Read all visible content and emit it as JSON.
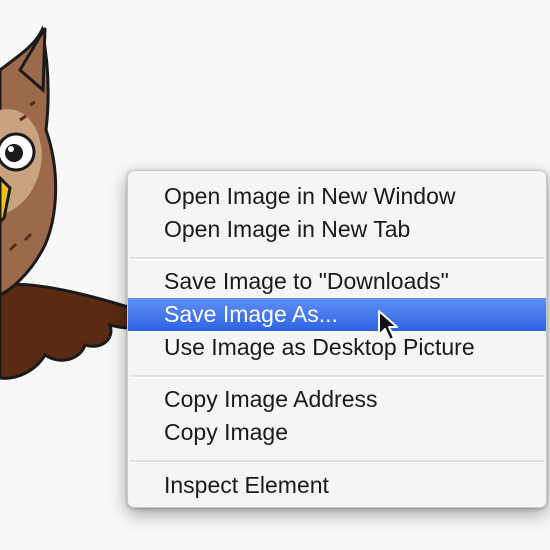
{
  "background_image": {
    "subject": "owl-illustration",
    "colors": {
      "body": "#9b6a4a",
      "wing": "#5a2a12",
      "eye_white": "#ffffff",
      "beak": "#f2c21b",
      "outline": "#1a1a1a"
    }
  },
  "context_menu": {
    "groups": [
      {
        "items": [
          {
            "label": "Open Image in New Window",
            "highlighted": false
          },
          {
            "label": "Open Image in New Tab",
            "highlighted": false
          }
        ]
      },
      {
        "items": [
          {
            "label": "Save Image to \"Downloads\"",
            "highlighted": false
          },
          {
            "label": "Save Image As...",
            "highlighted": true
          },
          {
            "label": "Use Image as Desktop Picture",
            "highlighted": false
          }
        ]
      },
      {
        "items": [
          {
            "label": "Copy Image Address",
            "highlighted": false
          },
          {
            "label": "Copy Image",
            "highlighted": false
          }
        ]
      },
      {
        "items": [
          {
            "label": "Inspect Element",
            "highlighted": false
          }
        ]
      }
    ],
    "colors": {
      "highlight": "#3b6fe8",
      "text": "#1a1a1a",
      "highlight_text": "#ffffff",
      "background": "#f5f5f5"
    }
  },
  "cursor": {
    "icon": "arrow-cursor-icon"
  }
}
